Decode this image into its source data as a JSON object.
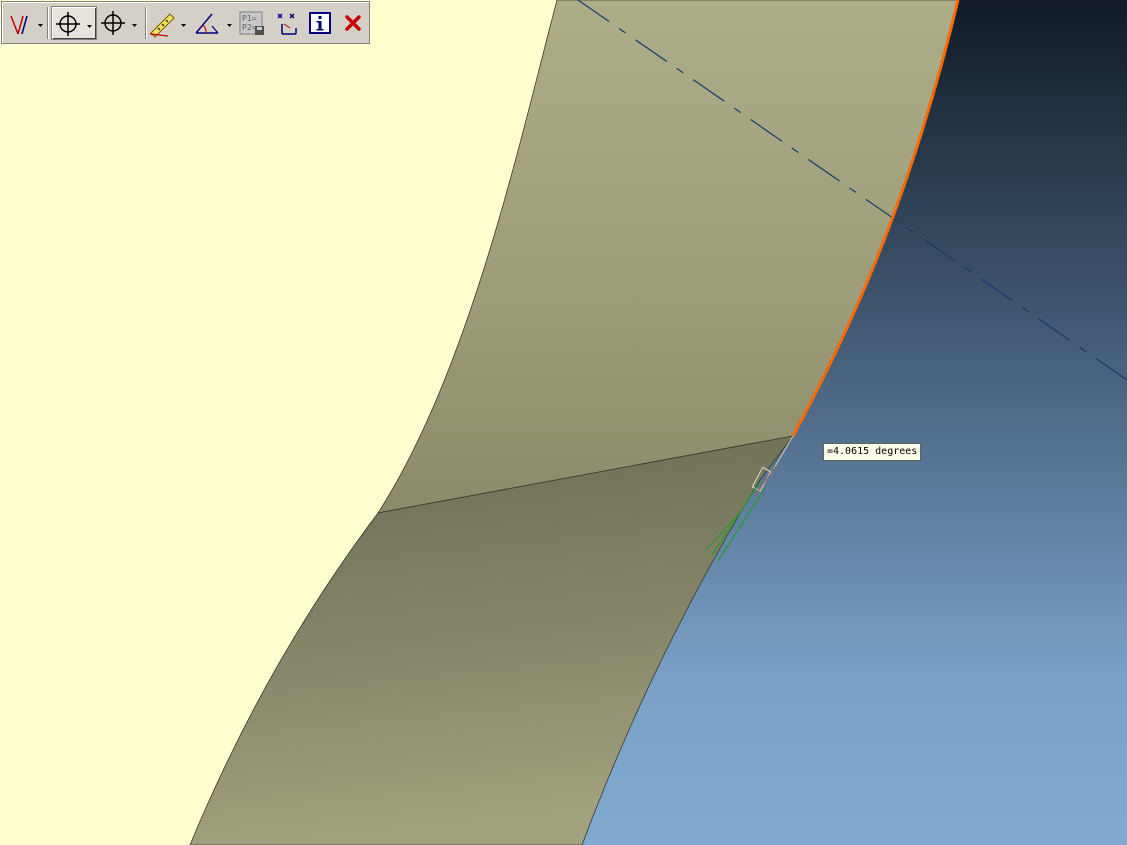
{
  "measurement": {
    "angle_label": "=4.0615 degrees"
  },
  "toolbar": {
    "buttons": [
      {
        "name": "sketch-lines-tool",
        "icon": "angled-lines-icon",
        "has_dropdown": true
      },
      {
        "name": "crosshair-point-tool",
        "icon": "crosshair-icon",
        "has_dropdown": true,
        "pressed": true
      },
      {
        "name": "crosshair-point-tool-2",
        "icon": "crosshair-icon",
        "has_dropdown": true
      },
      {
        "name": "measure-ruler-tool",
        "icon": "ruler-icon",
        "has_dropdown": true
      },
      {
        "name": "angle-measure-tool",
        "icon": "angle-icon",
        "has_dropdown": true
      },
      {
        "name": "p1-p2-save-tool",
        "icon": "p1-p2-save-icon",
        "label": "P1= P2="
      },
      {
        "name": "coordinate-tool",
        "icon": "coordinate-icon"
      },
      {
        "name": "info-button",
        "icon": "info-icon"
      },
      {
        "name": "close-button",
        "icon": "close-icon"
      }
    ]
  },
  "colors": {
    "background": "#ffffd0",
    "face_tan": "#a7a782",
    "face_dark": "#737358",
    "gradient_top": "#111a26",
    "gradient_bottom": "#82a9d0",
    "edge_highlight": "#ff6a00",
    "centerline": "#1a3a6a"
  }
}
